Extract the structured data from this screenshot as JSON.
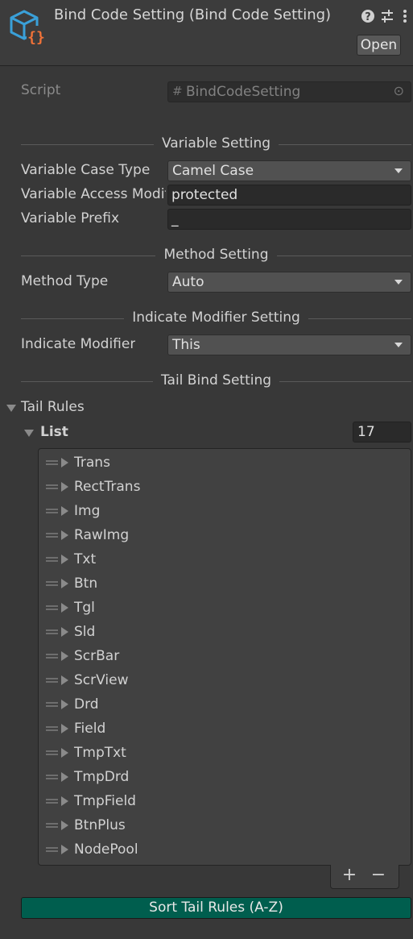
{
  "header": {
    "title": "Bind Code Setting (Bind Code Setting)",
    "icon": "script-object-icon",
    "help_icon": "?",
    "settings_icon": "⊶",
    "menu_icon": "⋮",
    "open_label": "Open"
  },
  "script": {
    "label": "Script",
    "value": "BindCodeSetting",
    "hash_icon": "#",
    "picker_icon": "⊙"
  },
  "variable_setting": {
    "title": "Variable Setting",
    "case_type": {
      "label": "Variable Case Type",
      "value": "Camel Case"
    },
    "access_modifier": {
      "label": "Variable Access Modifier",
      "value": "protected"
    },
    "prefix": {
      "label": "Variable Prefix",
      "value": "_"
    }
  },
  "method_setting": {
    "title": "Method Setting",
    "method_type": {
      "label": "Method Type",
      "value": "Auto"
    }
  },
  "indicate_modifier_setting": {
    "title": "Indicate Modifier Setting",
    "indicate_modifier": {
      "label": "Indicate Modifier",
      "value": "This"
    }
  },
  "tail_bind_setting": {
    "title": "Tail Bind Setting",
    "tail_rules_label": "Tail Rules",
    "list_label": "List",
    "list_count": "17",
    "items": [
      "Trans",
      "RectTrans",
      "Img",
      "RawImg",
      "Txt",
      "Btn",
      "Tgl",
      "Sld",
      "ScrBar",
      "ScrView",
      "Drd",
      "Field",
      "TmpTxt",
      "TmpDrd",
      "TmpField",
      "BtnPlus",
      "NodePool"
    ],
    "add_label": "+",
    "remove_label": "−",
    "sort_button_label": "Sort Tail Rules (A-Z)"
  },
  "colors": {
    "background": "#383838",
    "sort_button": "#005e4e",
    "icon_blue": "#3aa0d8",
    "icon_orange": "#f07238"
  }
}
